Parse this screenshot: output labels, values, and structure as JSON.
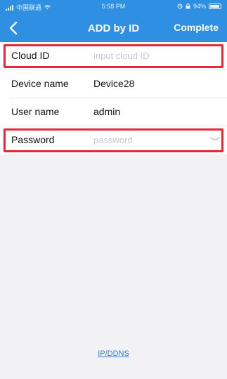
{
  "status_bar": {
    "carrier": "中国联通",
    "time": "5:58 PM",
    "battery": "94%",
    "battery_level": 0.94
  },
  "nav": {
    "title": "ADD by ID",
    "complete_label": "Complete",
    "back_icon": "chevron-left-icon"
  },
  "form": {
    "cloud_id": {
      "label": "Cloud ID",
      "placeholder": "input cloud ID",
      "value": ""
    },
    "device_name": {
      "label": "Device name",
      "value": "Device28"
    },
    "user_name": {
      "label": "User name",
      "value": "admin"
    },
    "password": {
      "label": "Password",
      "placeholder": "password",
      "value": "",
      "toggle_icon": "eye-closed-icon"
    }
  },
  "footer": {
    "link_label": "IP/DDNS"
  },
  "colors": {
    "header": "#2f8fe3",
    "highlight": "#e5293a",
    "link": "#3a7fd8"
  }
}
